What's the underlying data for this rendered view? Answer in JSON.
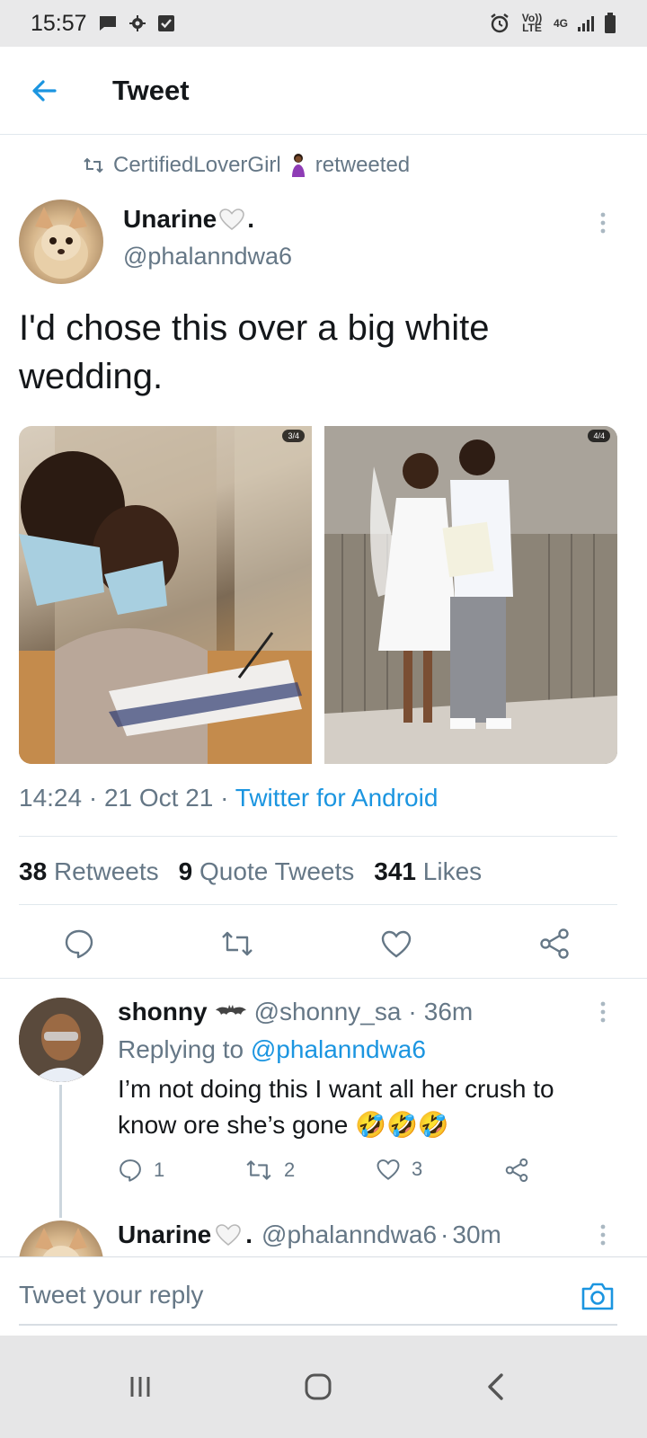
{
  "status_bar": {
    "time": "15:57",
    "network": "Vo)) LTE",
    "signal_label": "4G",
    "icons": [
      "chat-icon",
      "gear-icon",
      "checkbox-icon",
      "alarm-icon",
      "signal-icon",
      "battery-icon"
    ]
  },
  "header": {
    "title": "Tweet",
    "back_icon": "arrow-left-icon"
  },
  "retweet": {
    "user": "CertifiedLoverGirl",
    "suffix": "retweeted"
  },
  "tweet": {
    "author_name": "Unarine",
    "author_name_suffix": ".",
    "author_handle": "@phalanndwa6",
    "text": "I'd chose this over a big white wedding.",
    "media": [
      {
        "badge": "3/4"
      },
      {
        "badge": "4/4"
      }
    ],
    "time": "14:24",
    "date": "21 Oct 21",
    "source": "Twitter for Android",
    "stats": {
      "retweets_count": "38",
      "retweets_label": "Retweets",
      "quotes_count": "9",
      "quotes_label": "Quote Tweets",
      "likes_count": "341",
      "likes_label": "Likes"
    }
  },
  "reply": {
    "author_name": "shonny",
    "author_handle": "@shonny_sa",
    "age": "36m",
    "replying_prefix": "Replying to",
    "replying_to": "@phalanndwa6",
    "text": "I’m not doing this I want all her crush to know ore she’s gone 🤣🤣🤣",
    "reply_count": "1",
    "retweet_count": "2",
    "like_count": "3"
  },
  "reply2": {
    "author_name": "Unarine",
    "author_handle": "@phalanndwa6",
    "age": "30m"
  },
  "composer": {
    "placeholder": "Tweet your reply"
  },
  "colors": {
    "accent": "#1b95e0",
    "muted": "#657786",
    "text": "#14171a"
  }
}
